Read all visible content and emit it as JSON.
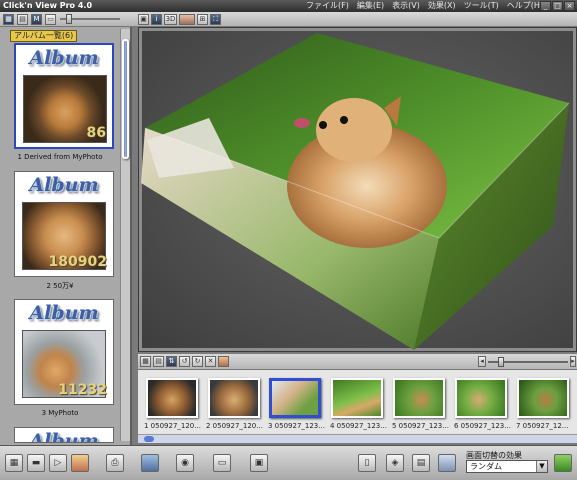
{
  "app": {
    "title": "Click'n View Pro 4.0"
  },
  "menu": [
    "ファイル(F)",
    "編集(E)",
    "表示(V)",
    "効果(X)",
    "ツール(T)",
    "ヘルプ(H)"
  ],
  "window_buttons": {
    "minimize": "_",
    "maximize": "□",
    "close": "×"
  },
  "toolbar": {
    "icons": [
      "tile-view-icon",
      "save-icon",
      "m-icon",
      "folder-icon",
      "image-mode-icon",
      "info-icon",
      "3d-icon",
      "image-icon",
      "zoom-icon",
      "fullscreen-icon"
    ],
    "m_label": "M",
    "info_label": "i",
    "threed_label": "3D"
  },
  "sidebar": {
    "label": "アルバム一覧",
    "count": "(6)",
    "albums": [
      {
        "title": "Album",
        "number": "86",
        "caption": "1 Derived from MyPhoto"
      },
      {
        "title": "Album",
        "number": "180902",
        "caption": "2 50万¥"
      },
      {
        "title": "Album",
        "number": "11232",
        "caption": "3 MyPhoto"
      },
      {
        "title": "Album",
        "number": "",
        "caption": ""
      }
    ]
  },
  "strip": {
    "thumbnails": [
      "1 050927_120...",
      "2 050927_120...",
      "3 050927_123...",
      "4 050927_123...",
      "5 050927_123...",
      "6 050927_123...",
      "7 050927_12..."
    ]
  },
  "bottombar": {
    "effect_label": "画面切替の効果",
    "effect_value": "ランダム"
  },
  "colors": {
    "accent": "#2d49b8",
    "album_text": "#3b5fa8",
    "number_text": "#e9d27a"
  }
}
